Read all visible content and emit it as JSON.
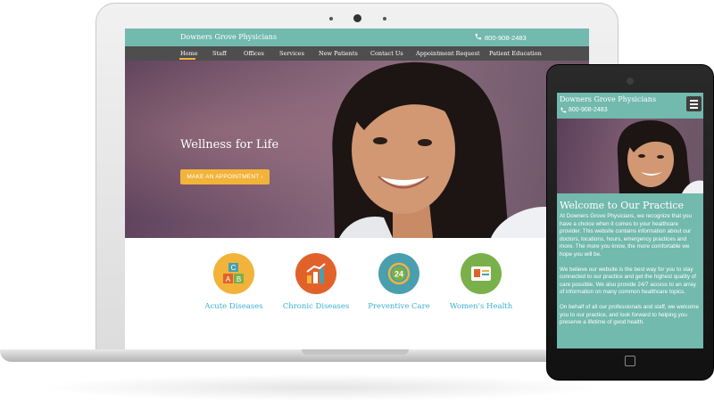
{
  "desktop_site": {
    "brand": "Downers Grove Physicians",
    "phone": "800-908-2483",
    "nav": [
      "Home",
      "Staff",
      "Offices",
      "Services",
      "New Patients",
      "Contact Us",
      "Appointment Request",
      "Patient Education"
    ],
    "active_nav": "Home",
    "hero": {
      "title": "Wellness for Life",
      "button": "MAKE AN APPOINTMENT ›"
    },
    "services": [
      {
        "label": "Acute Diseases",
        "icon": "abc-blocks-icon",
        "color": "#f2b33a"
      },
      {
        "label": "Chronic Diseases",
        "icon": "bar-chart-icon",
        "color": "#e0622a"
      },
      {
        "label": "Preventive Care",
        "icon": "24-hour-icon",
        "color": "#4a9fae"
      },
      {
        "label": "Women's Health",
        "icon": "id-card-icon",
        "color": "#7ab04a"
      }
    ]
  },
  "mobile_site": {
    "brand": "Downers Grove Physicians",
    "phone": "800-908-2483",
    "title": "Welcome to Our Practice",
    "paragraphs": [
      "At Downers Grove Physicians, we recognize that you have a choice when it comes to your healthcare provider. This website contains information about our doctors, locations, hours, emergency practices and more. The more you know, the more comfortable we hope you will be.",
      "We believe our website is the best way for you to stay connected to our practice and get the highest quality of care possible. We also provide 24/7 access to an array of information on many common healthcare topics.",
      "On behalf of all our professionals and staff, we welcome you to our practice, and look forward to helping you preserve a lifetime of good health."
    ]
  },
  "colors": {
    "teal": "#72b9ae",
    "nav_dark": "#4e4e4e",
    "accent_orange": "#f2b33a",
    "service_label": "#3bb0d0"
  }
}
